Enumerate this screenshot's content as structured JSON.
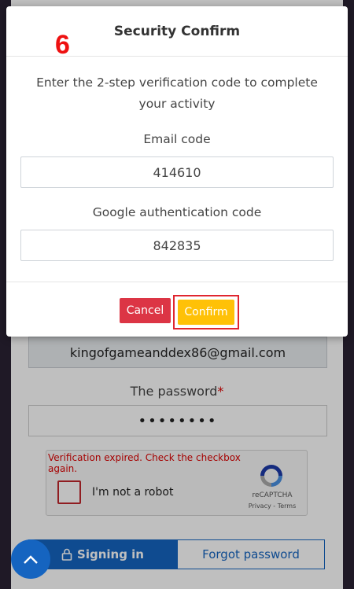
{
  "modal": {
    "title": "Security Confirm",
    "step_number": "6",
    "instruction": "Enter the 2-step verification code to complete your activity",
    "email_code_label": "Email code",
    "email_code_value": "414610",
    "google_code_label": "Google authentication code",
    "google_code_value": "842835",
    "cancel_label": "Cancel",
    "confirm_label": "Confirm"
  },
  "login": {
    "email": "kingofgameanddex86@gmail.com",
    "password_label": "The password",
    "required_mark": "*",
    "password_masked": "••••••••",
    "signin_label": "Signing in",
    "forgot_label": "Forgot password"
  },
  "recaptcha": {
    "error_text": "Verification expired. Check the checkbox again.",
    "checkbox_label": "I'm not a robot",
    "brand": "reCAPTCHA",
    "links": "Privacy - Terms"
  },
  "colors": {
    "cancel": "#dc3545",
    "confirm": "#ffc107",
    "highlight": "#e0262f",
    "primary": "#1564c0"
  }
}
